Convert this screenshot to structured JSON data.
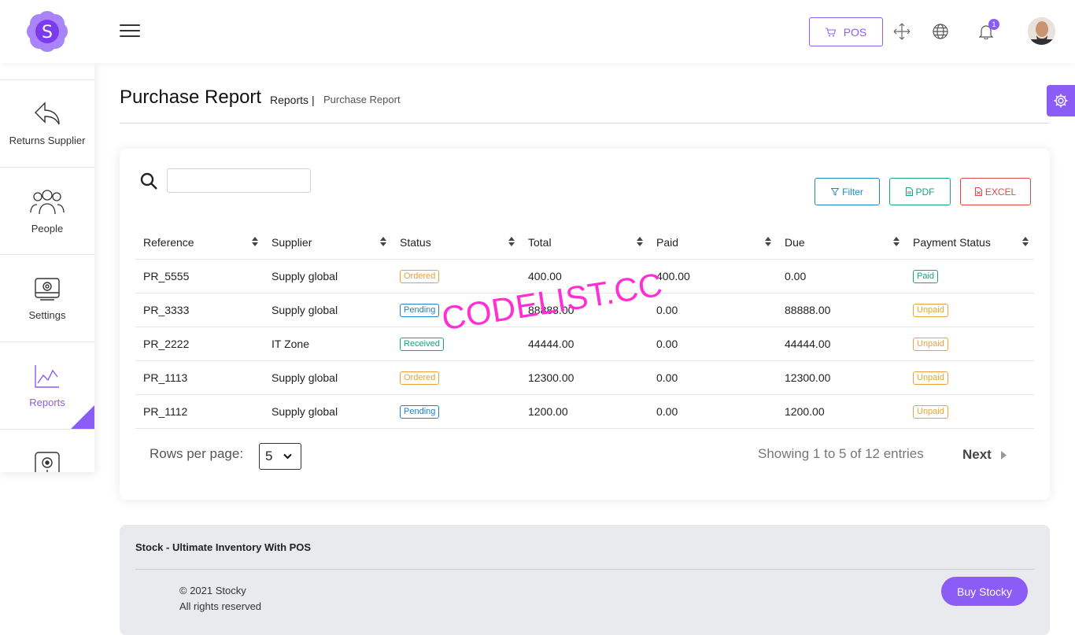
{
  "brand": {
    "logo_letter": "S",
    "accent": "#8b5cf6"
  },
  "header": {
    "pos_label": "POS",
    "notification_count": "1"
  },
  "sidebar": {
    "items": [
      {
        "label": "Returns Supplier",
        "icon": "reply-arrow-icon"
      },
      {
        "label": "People",
        "icon": "people-icon"
      },
      {
        "label": "Settings",
        "icon": "settings-icon"
      },
      {
        "label": "Reports",
        "icon": "chart-line-icon",
        "active": true
      },
      {
        "label": "",
        "icon": "safe-icon"
      }
    ]
  },
  "breadcrumb": {
    "title": "Purchase Report",
    "parent": "Reports",
    "separator": "|",
    "current": "Purchase Report"
  },
  "toolbar": {
    "search_placeholder": "",
    "filter_label": "Filter",
    "pdf_label": "PDF",
    "excel_label": "EXCEL"
  },
  "table": {
    "columns": [
      "Reference",
      "Supplier",
      "Status",
      "Total",
      "Paid",
      "Due",
      "Payment Status"
    ],
    "rows": [
      {
        "reference": "PR_5555",
        "supplier": "Supply global",
        "status": "Ordered",
        "total": "400.00",
        "paid": "400.00",
        "due": "0.00",
        "payment_status": "Paid"
      },
      {
        "reference": "PR_3333",
        "supplier": "Supply global",
        "status": "Pending",
        "total": "88888.00",
        "paid": "0.00",
        "due": "88888.00",
        "payment_status": "Unpaid"
      },
      {
        "reference": "PR_2222",
        "supplier": "IT Zone",
        "status": "Received",
        "total": "44444.00",
        "paid": "0.00",
        "due": "44444.00",
        "payment_status": "Unpaid"
      },
      {
        "reference": "PR_1113",
        "supplier": "Supply global",
        "status": "Ordered",
        "total": "12300.00",
        "paid": "0.00",
        "due": "12300.00",
        "payment_status": "Unpaid"
      },
      {
        "reference": "PR_1112",
        "supplier": "Supply global",
        "status": "Pending",
        "total": "1200.00",
        "paid": "0.00",
        "due": "1200.00",
        "payment_status": "Unpaid"
      }
    ]
  },
  "pagination": {
    "rows_per_page_label": "Rows per page:",
    "rows_per_page_value": "5",
    "showing": "Showing 1 to 5 of 12 entries",
    "next_label": "Next"
  },
  "watermark": "CODELIST.CC",
  "footer": {
    "title": "Stock - Ultimate Inventory With POS",
    "copyright": "© 2021 Stocky",
    "rights": "All rights reserved",
    "buy_label": "Buy Stocky"
  }
}
